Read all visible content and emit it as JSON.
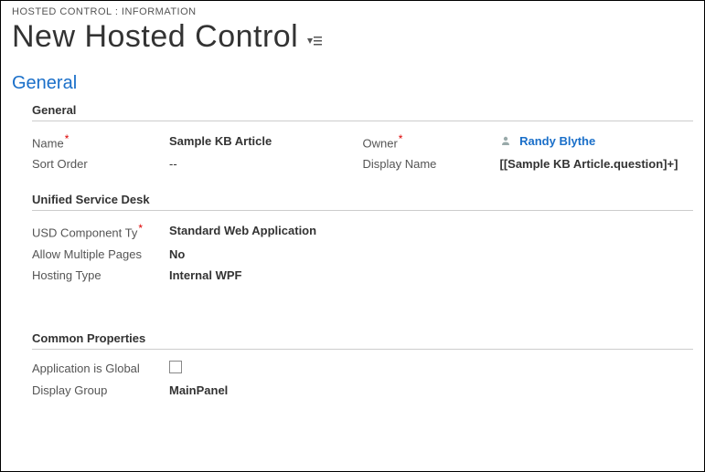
{
  "breadcrumb": "HOSTED CONTROL : INFORMATION",
  "title": "New Hosted Control",
  "section_heading": "General",
  "sections": {
    "general": {
      "title": "General",
      "name_label": "Name",
      "name_value": "Sample KB Article",
      "owner_label": "Owner",
      "owner_value": "Randy Blythe",
      "sort_label": "Sort Order",
      "sort_value": "--",
      "display_name_label": "Display Name",
      "display_name_value": "[[Sample KB Article.question]+]"
    },
    "usd": {
      "title": "Unified Service Desk",
      "component_label": "USD Component Ty",
      "component_value": "Standard Web Application",
      "allow_multi_label": "Allow Multiple Pages",
      "allow_multi_value": "No",
      "hosting_label": "Hosting Type",
      "hosting_value": "Internal WPF"
    },
    "common": {
      "title": "Common Properties",
      "global_label": "Application is Global",
      "global_checked": false,
      "display_group_label": "Display Group",
      "display_group_value": "MainPanel"
    }
  }
}
